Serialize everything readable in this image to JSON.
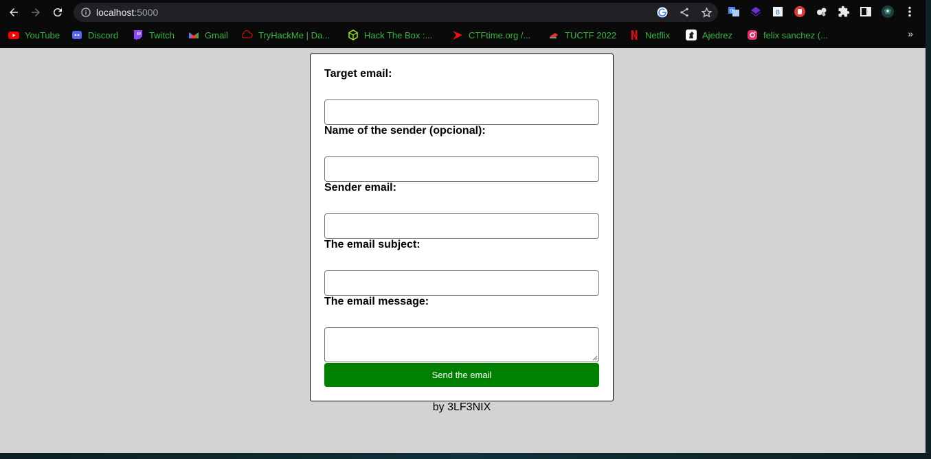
{
  "browser": {
    "url_host": "localhost",
    "url_port": ":5000",
    "icons": {
      "back": "arrow-left-icon",
      "forward": "arrow-right-icon",
      "reload": "reload-icon",
      "info": "info-icon",
      "google": "google-icon",
      "share": "share-icon",
      "bookmark": "star-icon",
      "extensions": "puzzle-icon",
      "sidepanel": "side-panel-icon",
      "menu": "kebab-menu-icon"
    }
  },
  "bookmarks": [
    {
      "label": "YouTube",
      "icon": "youtube-icon",
      "color": "#ff0000"
    },
    {
      "label": "Discord",
      "icon": "discord-icon",
      "color": "#5865f2"
    },
    {
      "label": "Twitch",
      "icon": "twitch-icon",
      "color": "#9146ff"
    },
    {
      "label": "Gmail",
      "icon": "gmail-icon",
      "color": "#ea4335"
    },
    {
      "label": "TryHackMe | Da...",
      "icon": "tryhackme-icon",
      "color": "#c11111"
    },
    {
      "label": "Hack The Box :...",
      "icon": "hackthebox-icon",
      "color": "#9fef00"
    },
    {
      "label": "CTFtime.org /...",
      "icon": "ctftime-icon",
      "color": "#e11"
    },
    {
      "label": "TUCTF 2022",
      "icon": "tuctf-icon",
      "color": "#d33"
    },
    {
      "label": "Netflix",
      "icon": "netflix-icon",
      "color": "#e50914"
    },
    {
      "label": "Ajedrez",
      "icon": "chess-icon",
      "color": "#ffffff"
    },
    {
      "label": "felix sanchez (...",
      "icon": "instagram-icon",
      "color": "#e1306c"
    }
  ],
  "bookmarks_more": "»",
  "form": {
    "target_email_label": "Target email:",
    "target_email_value": "",
    "sender_name_label": "Name of the sender (opcional):",
    "sender_name_value": "",
    "sender_email_label": "Sender email:",
    "sender_email_value": "",
    "subject_label": "The email subject:",
    "subject_value": "",
    "message_label": "The email message:",
    "message_value": "",
    "submit_label": "Send the email",
    "submit_color": "#008000"
  },
  "credit": "by 3LF3NIX",
  "colors": {
    "page_bg": "#d3d3d3",
    "link_green": "#35b73c"
  }
}
